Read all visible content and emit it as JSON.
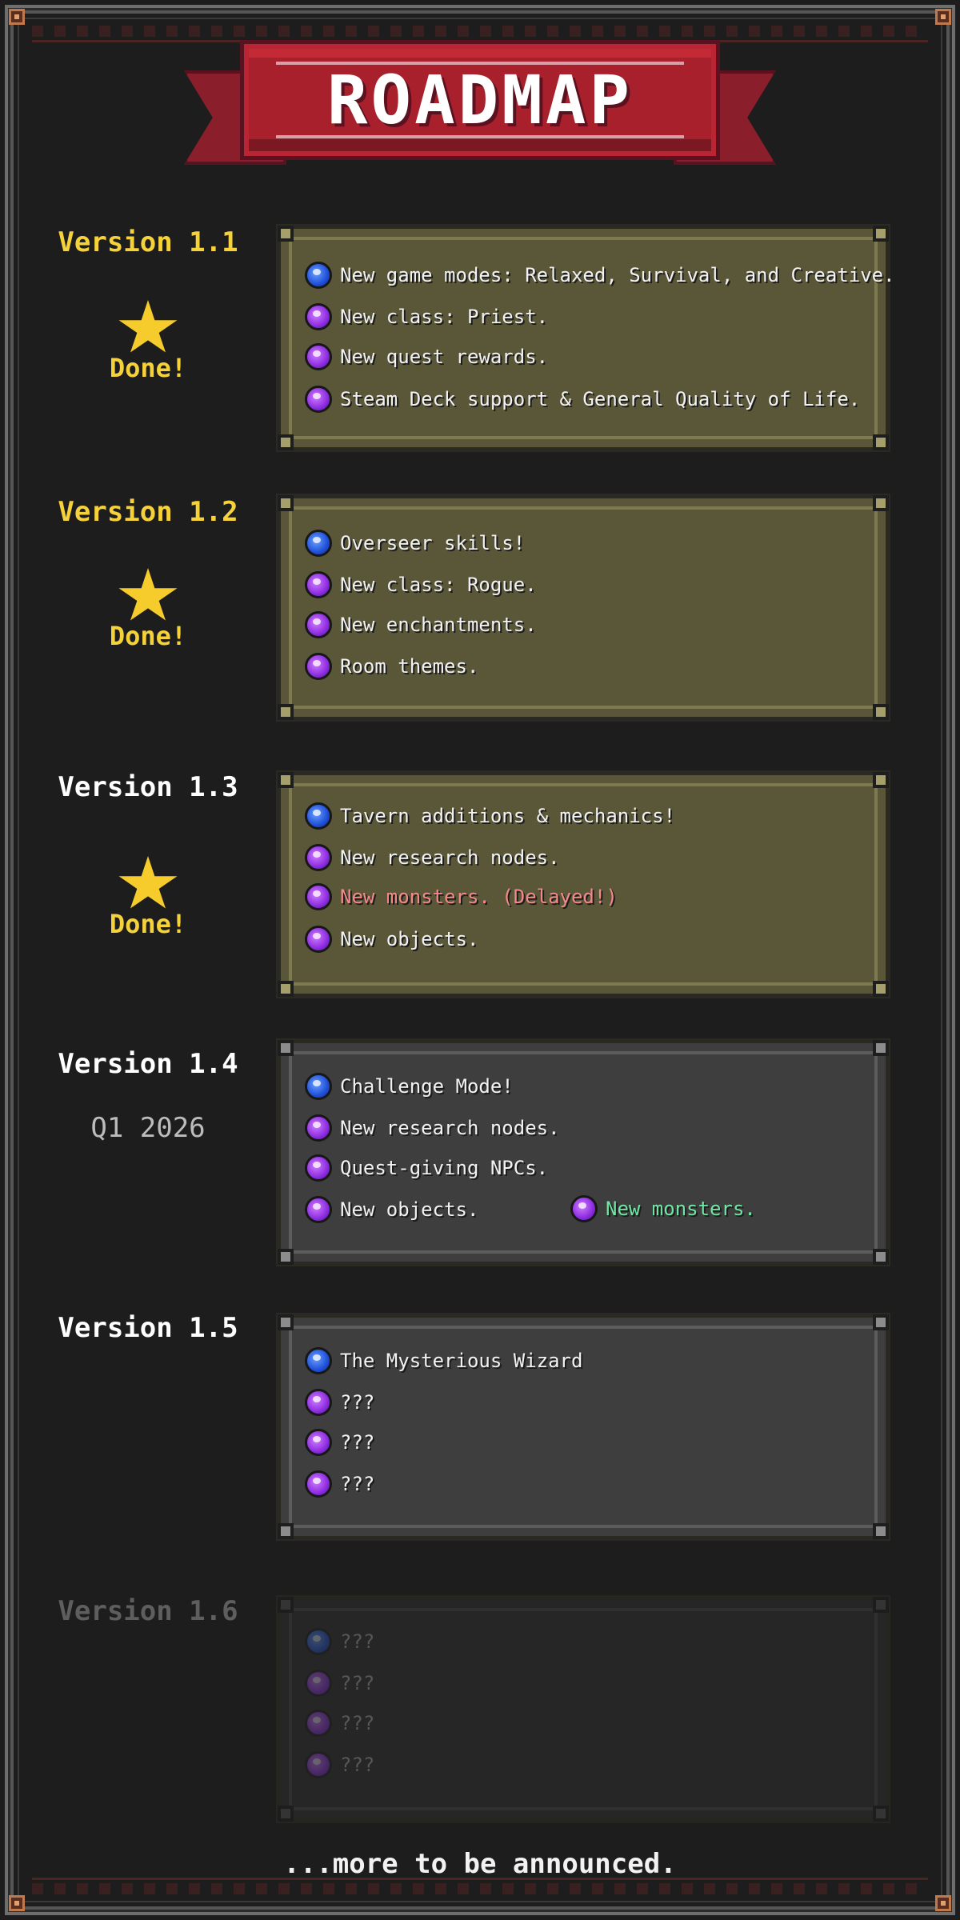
{
  "title": "ROADMAP",
  "footer": "...more to be announced.",
  "colors": {
    "version_done": "#f5d23a",
    "version_active": "#ffffff",
    "version_future": "#5e5e5e",
    "delayed": "#f28a8a",
    "highlight": "#6fe6a4"
  },
  "versions": [
    {
      "label": "Version 1.1",
      "status": "Done!",
      "items": [
        {
          "icon": "blue-orb-icon",
          "text": "New game modes: Relaxed, Survival, and Creative."
        },
        {
          "icon": "purple-orb-icon",
          "text": "New class: Priest."
        },
        {
          "icon": "purple-orb-icon",
          "text": "New quest rewards."
        },
        {
          "icon": "purple-orb-icon",
          "text": "Steam Deck support & General Quality of Life."
        }
      ]
    },
    {
      "label": "Version 1.2",
      "status": "Done!",
      "items": [
        {
          "icon": "blue-orb-icon",
          "text": "Overseer skills!"
        },
        {
          "icon": "purple-orb-icon",
          "text": "New class: Rogue."
        },
        {
          "icon": "purple-orb-icon",
          "text": "New enchantments."
        },
        {
          "icon": "purple-orb-icon",
          "text": "Room themes."
        }
      ]
    },
    {
      "label": "Version 1.3",
      "status": "Done!",
      "items": [
        {
          "icon": "blue-orb-icon",
          "text": "Tavern additions & mechanics!"
        },
        {
          "icon": "purple-orb-icon",
          "text": "New research nodes."
        },
        {
          "icon": "purple-orb-icon",
          "text": "New monsters. (Delayed!)"
        },
        {
          "icon": "purple-orb-icon",
          "text": "New objects."
        }
      ]
    },
    {
      "label": "Version 1.4",
      "quarter": "Q1 2026",
      "items": [
        {
          "icon": "blue-orb-icon",
          "text": "Challenge Mode!"
        },
        {
          "icon": "purple-orb-icon",
          "text": "New research nodes."
        },
        {
          "icon": "purple-orb-icon",
          "text": "Quest-giving NPCs."
        },
        {
          "icon": "purple-orb-icon",
          "text": "New objects."
        },
        {
          "icon": "purple-orb-icon",
          "text": "New monsters."
        }
      ]
    },
    {
      "label": "Version 1.5",
      "items": [
        {
          "icon": "blue-orb-icon",
          "text": "The Mysterious Wizard"
        },
        {
          "icon": "purple-orb-icon",
          "text": "???"
        },
        {
          "icon": "purple-orb-icon",
          "text": "???"
        },
        {
          "icon": "purple-orb-icon",
          "text": "???"
        }
      ]
    },
    {
      "label": "Version 1.6",
      "items": [
        {
          "icon": "blue-orb-icon",
          "text": "???"
        },
        {
          "icon": "purple-orb-icon",
          "text": "???"
        },
        {
          "icon": "purple-orb-icon",
          "text": "???"
        },
        {
          "icon": "purple-orb-icon",
          "text": "???"
        }
      ]
    }
  ]
}
